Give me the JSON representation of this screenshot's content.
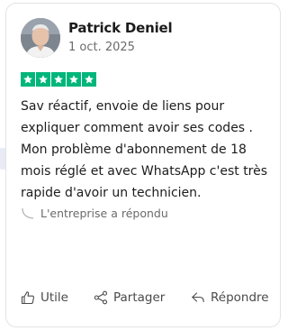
{
  "review": {
    "author": "Patrick Deniel",
    "date": "1 oct. 2025",
    "rating": 5,
    "rating_max": 5,
    "star_color": "#00b67a",
    "text": "Sav réactif, envoie de liens pour expliquer comment avoir ses codes . Mon problème d'abonnement de 18 mois réglé et avec WhatsApp c'est très rapide d'avoir un technicien.",
    "reply_label": "L'entreprise a répondu"
  },
  "actions": {
    "useful_label": "Utile",
    "share_label": "Partager",
    "reply_label": "Répondre"
  },
  "icons": {
    "star": "star-icon",
    "useful": "thumbs-up-icon",
    "share": "share-icon",
    "reply": "reply-arrow-icon",
    "carousel_prev": "chevron-left-icon"
  }
}
